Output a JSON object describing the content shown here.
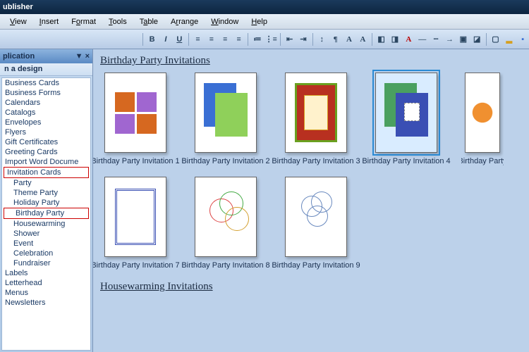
{
  "title": "ublisher",
  "menu": [
    "View",
    "Insert",
    "Format",
    "Tools",
    "Table",
    "Arrange",
    "Window",
    "Help"
  ],
  "sidebar": {
    "header": "plication",
    "subheader": "n a design",
    "categories": [
      "Business Cards",
      "Business Forms",
      "Calendars",
      "Catalogs",
      "Envelopes",
      "Flyers",
      "Gift Certificates",
      "Greeting Cards",
      "Import Word Docume",
      "Invitation Cards"
    ],
    "subcats": [
      "Party",
      "Theme Party",
      "Holiday Party",
      "Birthday Party",
      "Housewarming",
      "Shower",
      "Event",
      "Celebration",
      "Fundraiser"
    ],
    "categories2": [
      "Labels",
      "Letterhead",
      "Menus",
      "Newsletters"
    ],
    "boxed_cat": "Invitation Cards",
    "boxed_sub": "Birthday Party"
  },
  "content": {
    "section1": "Birthday Party Invitations",
    "section2": "Housewarming Invitations",
    "templates": [
      {
        "label": "Birthday Party Invitation 1"
      },
      {
        "label": "Birthday Party Invitation 2"
      },
      {
        "label": "Birthday Party Invitation 3"
      },
      {
        "label": "Birthday Party Invitation 4"
      },
      {
        "label": "Birthday Party"
      }
    ],
    "templates2": [
      {
        "label": "Birthday Party Invitation 7"
      },
      {
        "label": "Birthday Party Invitation 8"
      },
      {
        "label": "Birthday Party Invitation 9"
      }
    ],
    "selected": "Birthday Party Invitation 4"
  }
}
